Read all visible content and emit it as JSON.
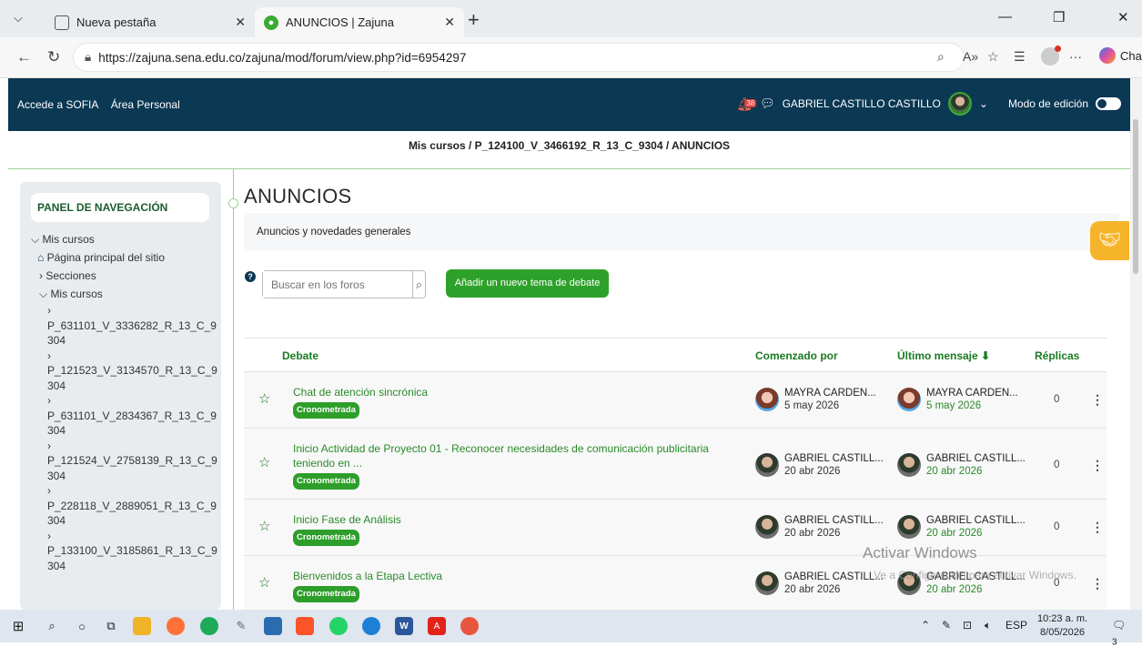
{
  "browser": {
    "tabs": [
      {
        "label": "Nueva pestaña"
      },
      {
        "label": "ANUNCIOS | Zajuna"
      }
    ],
    "url": "https://zajuna.sena.edu.co/zajuna/mod/forum/view.php?id=6954297",
    "chat_label": "Chat"
  },
  "header": {
    "links": [
      "Accede a SOFIA",
      "Área Personal"
    ],
    "notif_count": "38",
    "user_name": "GABRIEL CASTILLO CASTILLO",
    "edit_mode_label": "Modo de edición"
  },
  "breadcrumb": "Mis cursos / P_124100_V_3466192_R_13_C_9304 / ANUNCIOS",
  "nav": {
    "title": "PANEL DE NAVEGACIÓN",
    "mis_cursos": "Mis cursos",
    "home": "Página principal del sitio",
    "secciones": "Secciones",
    "mis_cursos_sub": "Mis cursos",
    "courses": [
      [
        "P_631101_V_3336282_R_13_C_9",
        "304"
      ],
      [
        "P_121523_V_3134570_R_13_C_9",
        "304"
      ],
      [
        "P_631101_V_2834367_R_13_C_9",
        "304"
      ],
      [
        "P_121524_V_2758139_R_13_C_9",
        "304"
      ],
      [
        "P_228118_V_2889051_R_13_C_9",
        "304"
      ],
      [
        "P_133100_V_3185861_R_13_C_9",
        "304"
      ]
    ]
  },
  "page": {
    "title": "ANUNCIOS",
    "intro": "Anuncios y novedades generales",
    "search_placeholder": "Buscar en los foros",
    "add_button": "Añadir un nuevo tema de debate"
  },
  "table": {
    "headers": {
      "debate": "Debate",
      "started_by": "Comenzado por",
      "last_post": "Último mensaje ⬇",
      "replies": "Réplicas"
    },
    "badge": "Cronometrada",
    "rows": [
      {
        "title": "Chat de atención sincrónica",
        "title2": "",
        "author": "MAYRA CARDEN...",
        "date": "5 may 2026",
        "last_author": "MAYRA CARDEN...",
        "last_date": "5 may 2026",
        "replies": "0"
      },
      {
        "title": "Inicio Actividad de Proyecto 01 - Reconocer necesidades de comunicación publicitaria",
        "title2": "teniendo en ...",
        "author": "GABRIEL CASTILL...",
        "date": "20 abr 2026",
        "last_author": "GABRIEL CASTILL...",
        "last_date": "20 abr 2026",
        "replies": "0"
      },
      {
        "title": "Inicio Fase de Análisis",
        "title2": "",
        "author": "GABRIEL CASTILL...",
        "date": "20 abr 2026",
        "last_author": "GABRIEL CASTILL...",
        "last_date": "20 abr 2026",
        "replies": "0"
      },
      {
        "title": "Bienvenidos a la Etapa Lectiva",
        "title2": "",
        "author": "GABRIEL CASTILL...",
        "date": "20 abr 2026",
        "last_author": "GABRIEL CASTILL...",
        "last_date": "20 abr 2026",
        "replies": "0"
      }
    ]
  },
  "watermark": {
    "line1": "Activar Windows",
    "line2": "Ve a Configuración para activar Windows."
  },
  "taskbar": {
    "lang": "ESP",
    "time": "10:23 a. m.",
    "date": "8/05/2026",
    "notif": "3"
  }
}
